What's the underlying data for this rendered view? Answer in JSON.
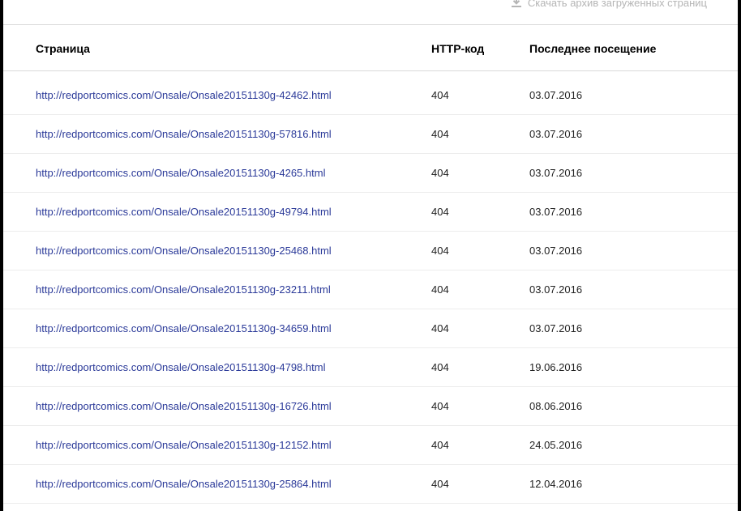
{
  "download": {
    "icon": "download-icon",
    "label": "Скачать архив загруженных страниц"
  },
  "table": {
    "columns": {
      "page": "Страница",
      "code": "HTTP-код",
      "date": "Последнее посещение"
    },
    "rows": [
      {
        "url": "http://redportcomics.com/Onsale/Onsale20151130g-42462.html",
        "code": "404",
        "date": "03.07.2016"
      },
      {
        "url": "http://redportcomics.com/Onsale/Onsale20151130g-57816.html",
        "code": "404",
        "date": "03.07.2016"
      },
      {
        "url": "http://redportcomics.com/Onsale/Onsale20151130g-4265.html",
        "code": "404",
        "date": "03.07.2016"
      },
      {
        "url": "http://redportcomics.com/Onsale/Onsale20151130g-49794.html",
        "code": "404",
        "date": "03.07.2016"
      },
      {
        "url": "http://redportcomics.com/Onsale/Onsale20151130g-25468.html",
        "code": "404",
        "date": "03.07.2016"
      },
      {
        "url": "http://redportcomics.com/Onsale/Onsale20151130g-23211.html",
        "code": "404",
        "date": "03.07.2016"
      },
      {
        "url": "http://redportcomics.com/Onsale/Onsale20151130g-34659.html",
        "code": "404",
        "date": "03.07.2016"
      },
      {
        "url": "http://redportcomics.com/Onsale/Onsale20151130g-4798.html",
        "code": "404",
        "date": "19.06.2016"
      },
      {
        "url": "http://redportcomics.com/Onsale/Onsale20151130g-16726.html",
        "code": "404",
        "date": "08.06.2016"
      },
      {
        "url": "http://redportcomics.com/Onsale/Onsale20151130g-12152.html",
        "code": "404",
        "date": "24.05.2016"
      },
      {
        "url": "http://redportcomics.com/Onsale/Onsale20151130g-25864.html",
        "code": "404",
        "date": "12.04.2016"
      }
    ]
  },
  "colors": {
    "link": "#2b3a99",
    "muted": "#b5b5b5",
    "frame": "#000000"
  }
}
